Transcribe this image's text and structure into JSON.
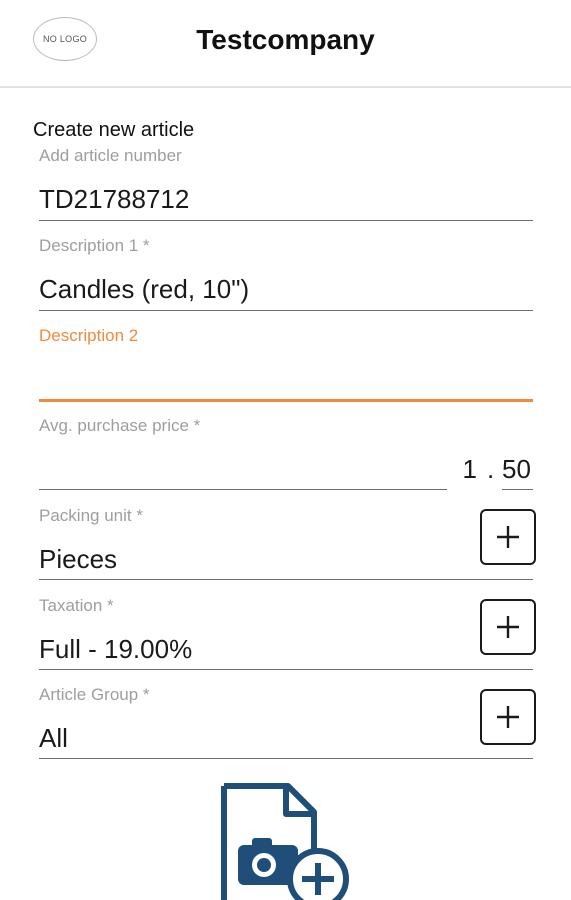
{
  "header": {
    "logo_text": "NO LOGO",
    "title": "Testcompany"
  },
  "form": {
    "title": "Create new article",
    "article_number": {
      "label": "Add article number",
      "value": "TD21788712"
    },
    "description1": {
      "label": "Description 1 *",
      "value": "Candles (red, 10\")"
    },
    "description2": {
      "label": "Description 2",
      "value": ""
    },
    "price": {
      "label": "Avg. purchase price *",
      "whole": "1",
      "separator": ".",
      "cents": "50"
    },
    "packing_unit": {
      "label": "Packing unit *",
      "value": "Pieces"
    },
    "taxation": {
      "label": "Taxation *",
      "value": "Full - 19.00%"
    },
    "article_group": {
      "label": "Article Group *",
      "value": "All"
    }
  },
  "icons": {
    "add": "plus-icon",
    "photo": "add-photo-icon"
  },
  "colors": {
    "accent": "#f08a3c",
    "icon_blue": "#1f4e79",
    "label_gray": "#9e9e9e"
  }
}
